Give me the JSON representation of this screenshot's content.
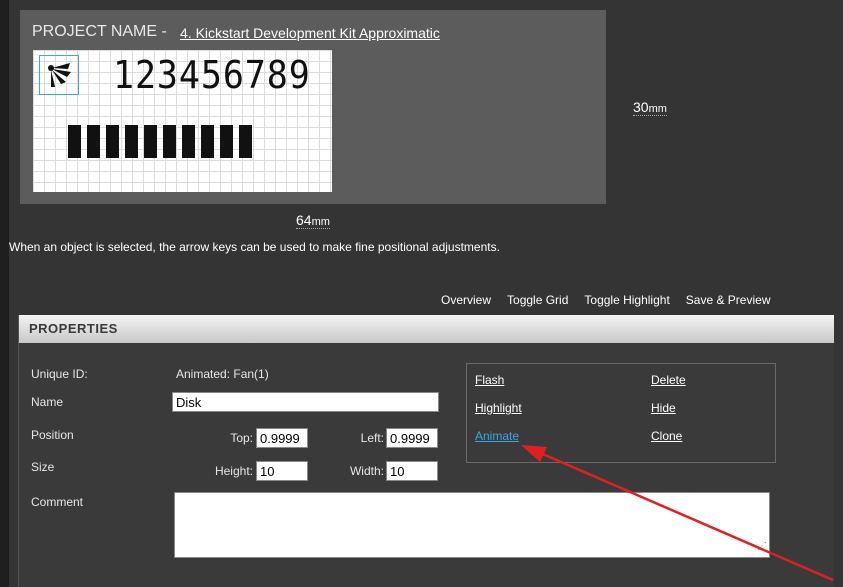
{
  "project": {
    "title_label": "PROJECT NAME -",
    "name": "4. Kickstart Development Kit Approximatic"
  },
  "canvas": {
    "digits": "123456789",
    "bar_count": 10
  },
  "dimensions": {
    "height_value": "30",
    "width_value": "64",
    "unit": "mm"
  },
  "hint": "When an object is selected, the arrow keys can be used to make fine positional adjustments.",
  "toolbar": {
    "overview": "Overview",
    "toggle_grid": "Toggle Grid",
    "toggle_highlight": "Toggle Highlight",
    "save_preview": "Save & Preview"
  },
  "properties": {
    "header": "PROPERTIES",
    "unique_id_label": "Unique ID:",
    "unique_id_value": "Animated: Fan(1)",
    "name_label": "Name",
    "name_value": "Disk",
    "position_label": "Position",
    "top_label": "Top:",
    "top_value": "0.9999",
    "left_label": "Left:",
    "left_value": "0.9999",
    "size_label": "Size",
    "height_label": "Height:",
    "height_value": "10",
    "width_label": "Width:",
    "width_value": "10",
    "comment_label": "Comment",
    "comment_value": ""
  },
  "actions": {
    "flash": "Flash",
    "highlight": "Highlight",
    "animate": "Animate",
    "delete": "Delete",
    "hide": "Hide",
    "clone": "Clone"
  },
  "colors": {
    "background": "#343434",
    "panel": "#5c5c5c",
    "selection": "#38a8e0",
    "link_active": "#3aa8e0",
    "annotation_arrow": "#e02020"
  }
}
